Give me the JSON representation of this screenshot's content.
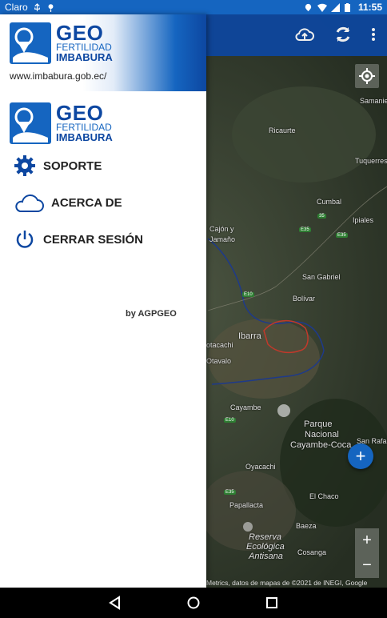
{
  "status_bar": {
    "carrier": "Claro",
    "time": "11:55"
  },
  "map": {
    "labels": [
      {
        "text": "Samanie",
        "cls": "",
        "name": "map-label-samanie"
      },
      {
        "text": "Ricaurte",
        "cls": "",
        "name": "map-label-ricaurte"
      },
      {
        "text": "Tuquerres",
        "cls": "",
        "name": "map-label-tuquerres"
      },
      {
        "text": "Cumbal",
        "cls": "",
        "name": "map-label-cumbal"
      },
      {
        "text": "Ipiales",
        "cls": "",
        "name": "map-label-ipiales"
      },
      {
        "text": "Cajón y",
        "cls": "",
        "name": "map-label-cajon"
      },
      {
        "text": "Jamaño",
        "cls": "",
        "name": "map-label-jamano"
      },
      {
        "text": "San Gabriel",
        "cls": "",
        "name": "map-label-san-gabriel"
      },
      {
        "text": "Bolívar",
        "cls": "",
        "name": "map-label-bolivar"
      },
      {
        "text": "Ibarra",
        "cls": "big",
        "name": "map-label-ibarra"
      },
      {
        "text": "otacachi",
        "cls": "",
        "name": "map-label-otacachi"
      },
      {
        "text": "Otavalo",
        "cls": "",
        "name": "map-label-otavalo"
      },
      {
        "text": "Cayambe",
        "cls": "",
        "name": "map-label-cayambe"
      },
      {
        "text": "Parque",
        "cls": "big",
        "name": "map-label-parque"
      },
      {
        "text": "Nacional",
        "cls": "big",
        "name": "map-label-nacional"
      },
      {
        "text": "Cayambe-Coca",
        "cls": "big",
        "name": "map-label-cayambe-coca"
      },
      {
        "text": "San Rafa",
        "cls": "",
        "name": "map-label-san-rafael"
      },
      {
        "text": "Oyacachi",
        "cls": "",
        "name": "map-label-oyacachi"
      },
      {
        "text": "El Chaco",
        "cls": "",
        "name": "map-label-el-chaco"
      },
      {
        "text": "Papallacta",
        "cls": "",
        "name": "map-label-papallacta"
      },
      {
        "text": "Baeza",
        "cls": "",
        "name": "map-label-baeza"
      },
      {
        "text": "Reserva",
        "cls": "big it",
        "name": "map-label-reserva"
      },
      {
        "text": "Ecológica",
        "cls": "big it",
        "name": "map-label-ecologica"
      },
      {
        "text": "Antisana",
        "cls": "big it",
        "name": "map-label-antisana"
      },
      {
        "text": "Cosanga",
        "cls": "",
        "name": "map-label-cosanga"
      }
    ],
    "road_shields": [
      "E10",
      "E10",
      "E35",
      "E35",
      "35",
      "E35"
    ],
    "fab_label": "+",
    "zoom_in": "+",
    "zoom_out": "−",
    "attribution": "Metrics, datos de mapas de ©2021 de INEGI, Google"
  },
  "drawer": {
    "header_logo": {
      "geo": "GEO",
      "fertilidad": "FERTILIDAD",
      "imbabura": "IMBABURA"
    },
    "url": "www.imbabura.gob.ec/",
    "body_logo": {
      "geo": "GEO",
      "fertilidad": "FERTILIDAD",
      "imbabura": "IMBABURA"
    },
    "menu": [
      {
        "label": "SOPORTE",
        "icon": "gear-icon"
      },
      {
        "label": "ACERCA DE",
        "icon": "cloud-icon"
      },
      {
        "label": "CERRAR SESIÓN",
        "icon": "power-icon"
      }
    ],
    "byline": "by AGPGEO"
  },
  "colors": {
    "primary": "#1565c0",
    "primary_dark": "#0d47a1",
    "boundary": "#c0392b"
  }
}
